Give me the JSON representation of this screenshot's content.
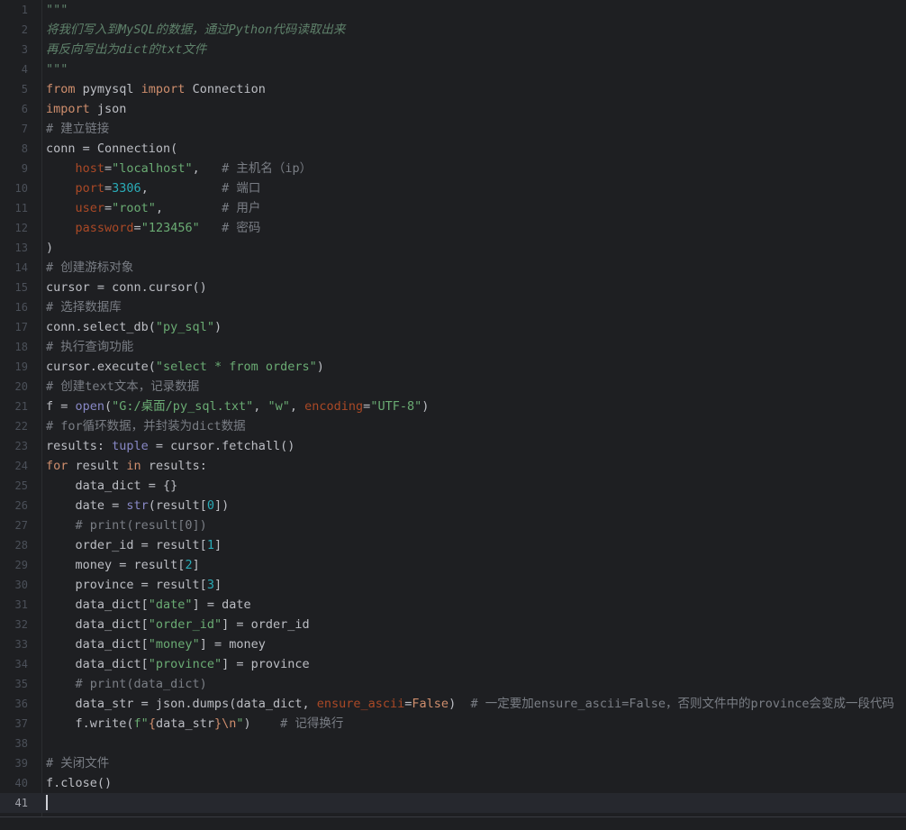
{
  "editor": {
    "current_line": 41,
    "lines": [
      [
        [
          "doc",
          "\"\"\""
        ]
      ],
      [
        [
          "doc",
          "将我们写入到MySQL的数据，通过Python代码读取出来"
        ]
      ],
      [
        [
          "doc",
          "再反向写出为dict的txt文件"
        ]
      ],
      [
        [
          "doc",
          "\"\"\""
        ]
      ],
      [
        [
          "kw",
          "from"
        ],
        [
          "p",
          " pymysql "
        ],
        [
          "kw",
          "import"
        ],
        [
          "p",
          " Connection"
        ]
      ],
      [
        [
          "kw",
          "import"
        ],
        [
          "p",
          " json"
        ]
      ],
      [
        [
          "cm",
          "# 建立链接"
        ]
      ],
      [
        [
          "p",
          "conn = Connection("
        ]
      ],
      [
        [
          "p",
          "    "
        ],
        [
          "param",
          "host"
        ],
        [
          "p",
          "="
        ],
        [
          "str",
          "\"localhost\""
        ],
        [
          "p",
          ",   "
        ],
        [
          "cm",
          "# 主机名（ip）"
        ]
      ],
      [
        [
          "p",
          "    "
        ],
        [
          "param",
          "port"
        ],
        [
          "p",
          "="
        ],
        [
          "num",
          "3306"
        ],
        [
          "p",
          ",          "
        ],
        [
          "cm",
          "# 端口"
        ]
      ],
      [
        [
          "p",
          "    "
        ],
        [
          "param",
          "user"
        ],
        [
          "p",
          "="
        ],
        [
          "str",
          "\"root\""
        ],
        [
          "p",
          ",        "
        ],
        [
          "cm",
          "# 用户"
        ]
      ],
      [
        [
          "p",
          "    "
        ],
        [
          "param",
          "password"
        ],
        [
          "p",
          "="
        ],
        [
          "str",
          "\"123456\""
        ],
        [
          "p",
          "   "
        ],
        [
          "cm",
          "# 密码"
        ]
      ],
      [
        [
          "p",
          ")"
        ]
      ],
      [
        [
          "cm",
          "# 创建游标对象"
        ]
      ],
      [
        [
          "p",
          "cursor = conn.cursor()"
        ]
      ],
      [
        [
          "cm",
          "# 选择数据库"
        ]
      ],
      [
        [
          "p",
          "conn.select_db("
        ],
        [
          "str",
          "\"py_sql\""
        ],
        [
          "p",
          ")"
        ]
      ],
      [
        [
          "cm",
          "# 执行查询功能"
        ]
      ],
      [
        [
          "p",
          "cursor.execute("
        ],
        [
          "str",
          "\"select * from orders\""
        ],
        [
          "p",
          ")"
        ]
      ],
      [
        [
          "cm",
          "# 创建text文本，记录数据"
        ]
      ],
      [
        [
          "p",
          "f = "
        ],
        [
          "bi",
          "open"
        ],
        [
          "p",
          "("
        ],
        [
          "str",
          "\"G:/桌面/py_sql.txt\""
        ],
        [
          "p",
          ", "
        ],
        [
          "str",
          "\"w\""
        ],
        [
          "p",
          ", "
        ],
        [
          "param",
          "encoding"
        ],
        [
          "p",
          "="
        ],
        [
          "str",
          "\"UTF-8\""
        ],
        [
          "p",
          ")"
        ]
      ],
      [
        [
          "cm",
          "# for循环数据，并封装为dict数据"
        ]
      ],
      [
        [
          "p",
          "results: "
        ],
        [
          "bi",
          "tuple"
        ],
        [
          "p",
          " = cursor.fetchall()"
        ]
      ],
      [
        [
          "kw",
          "for"
        ],
        [
          "p",
          " result "
        ],
        [
          "kw",
          "in"
        ],
        [
          "p",
          " results:"
        ]
      ],
      [
        [
          "p",
          "    data_dict = {}"
        ]
      ],
      [
        [
          "p",
          "    date = "
        ],
        [
          "bi",
          "str"
        ],
        [
          "p",
          "(result["
        ],
        [
          "num",
          "0"
        ],
        [
          "p",
          "])"
        ]
      ],
      [
        [
          "p",
          "    "
        ],
        [
          "cm",
          "# print(result[0])"
        ]
      ],
      [
        [
          "p",
          "    order_id = result["
        ],
        [
          "num",
          "1"
        ],
        [
          "p",
          "]"
        ]
      ],
      [
        [
          "p",
          "    money = result["
        ],
        [
          "num",
          "2"
        ],
        [
          "p",
          "]"
        ]
      ],
      [
        [
          "p",
          "    province = result["
        ],
        [
          "num",
          "3"
        ],
        [
          "p",
          "]"
        ]
      ],
      [
        [
          "p",
          "    data_dict["
        ],
        [
          "str",
          "\"date\""
        ],
        [
          "p",
          "] = date"
        ]
      ],
      [
        [
          "p",
          "    data_dict["
        ],
        [
          "str",
          "\"order_id\""
        ],
        [
          "p",
          "] = order_id"
        ]
      ],
      [
        [
          "p",
          "    data_dict["
        ],
        [
          "str",
          "\"money\""
        ],
        [
          "p",
          "] = money"
        ]
      ],
      [
        [
          "p",
          "    data_dict["
        ],
        [
          "str",
          "\"province\""
        ],
        [
          "p",
          "] = province"
        ]
      ],
      [
        [
          "p",
          "    "
        ],
        [
          "cm",
          "# print(data_dict)"
        ]
      ],
      [
        [
          "p",
          "    data_str = json.dumps(data_dict, "
        ],
        [
          "param",
          "ensure_ascii"
        ],
        [
          "p",
          "="
        ],
        [
          "kw",
          "False"
        ],
        [
          "p",
          ")  "
        ],
        [
          "cm",
          "# 一定要加ensure_ascii=False，否则文件中的province会变成一段代码"
        ]
      ],
      [
        [
          "p",
          "    f.write("
        ],
        [
          "str",
          "f\""
        ],
        [
          "esc",
          "{"
        ],
        [
          "p",
          "data_str"
        ],
        [
          "esc",
          "}"
        ],
        [
          "esc",
          "\\n"
        ],
        [
          "str",
          "\""
        ],
        [
          "p",
          ")    "
        ],
        [
          "cm",
          "# 记得换行"
        ]
      ],
      [],
      [
        [
          "cm",
          "# 关闭文件"
        ]
      ],
      [
        [
          "p",
          "f.close()"
        ]
      ],
      []
    ]
  },
  "colors": {
    "background": "#1e1f22",
    "keyword": "#cf8e6d",
    "string": "#6aab73",
    "number": "#2aacb8",
    "comment": "#7a7e85",
    "docstring": "#5f826b",
    "parameter": "#aa4926",
    "builtin": "#8888c6"
  }
}
